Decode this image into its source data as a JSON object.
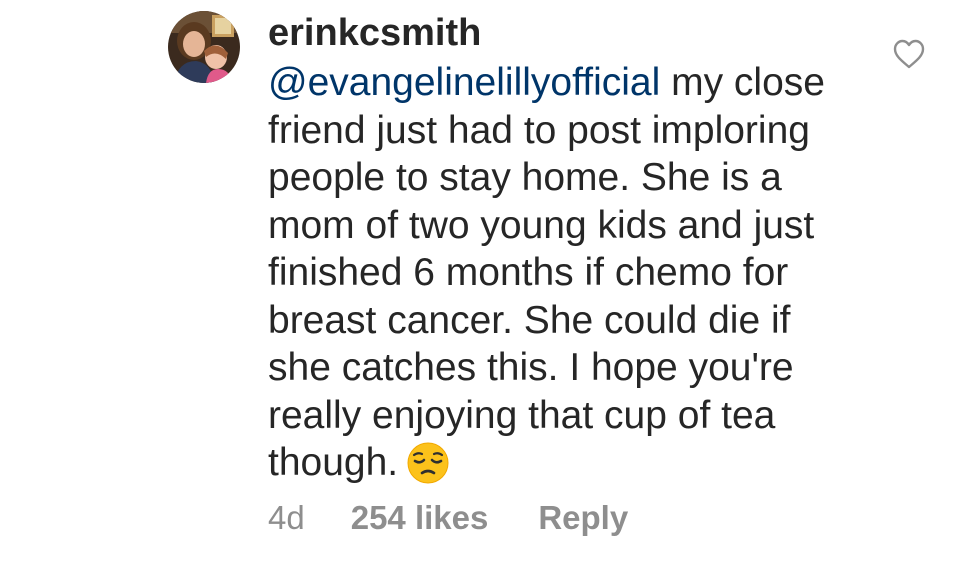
{
  "comment": {
    "username": "erinkcsmith",
    "mention": "@evangelinelillyofficial",
    "lines": [
      " my close",
      "friend just had to post imploring",
      "people to stay home. She is a",
      "mom of two young kids and just",
      "finished 6 months if chemo for",
      "breast cancer. She could die if",
      "she catches this. I hope you're",
      "really enjoying that cup of tea",
      "though."
    ],
    "emoji_icon": "pensive-face-emoji",
    "time_ago": "4d",
    "likes": "254 likes",
    "reply_label": "Reply",
    "like_icon": "heart-outline-icon"
  },
  "colors": {
    "text": "#262626",
    "mention": "#003569",
    "meta": "#8e8e8e"
  }
}
